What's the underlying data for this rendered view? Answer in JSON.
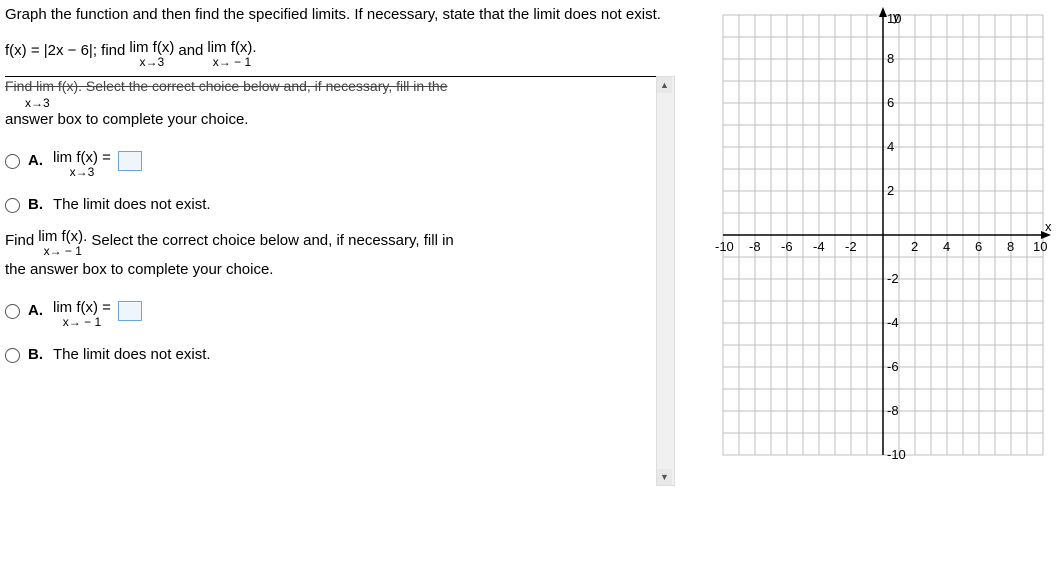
{
  "question": {
    "intro": "Graph the function and then find the specified limits. If necessary, state that the limit does not exist.",
    "func_prefix": "f(x) = |2x − 6|; find",
    "lim1_top": "lim f(x)",
    "lim1_bot": "x→3",
    "and": "and",
    "lim2_top": "lim  f(x).",
    "lim2_bot": "x→ − 1",
    "truncated_line": "Find  lim f(x). Select the correct choice below and, if necessary, fill in the",
    "trunc_sub_top": "x→3",
    "answer_box_text": "answer box to complete your choice."
  },
  "part1": {
    "A_label": "A.",
    "A_lim_top": "lim f(x) =",
    "A_lim_bot": "x→3",
    "B_label": "B.",
    "B_text": "The limit does not exist."
  },
  "part2": {
    "find_prefix": "Find",
    "lim_top": "lim  f(x).",
    "lim_bot": "x→ − 1",
    "find_suffix": "Select the correct choice below and, if necessary, fill in",
    "line2": "the answer box to complete your choice.",
    "A_label": "A.",
    "A_lim_top": "lim  f(x) =",
    "A_lim_bot": "x→ − 1",
    "B_label": "B.",
    "B_text": "The limit does not exist."
  },
  "chart_data": {
    "type": "line",
    "title": "",
    "xlabel": "x",
    "ylabel": "y",
    "xlim": [
      -10,
      10
    ],
    "ylim": [
      -10,
      10
    ],
    "x_ticks": [
      -10,
      -8,
      -6,
      -4,
      -2,
      2,
      4,
      6,
      8,
      10
    ],
    "y_ticks": [
      -10,
      -8,
      -6,
      -4,
      -2,
      2,
      4,
      6,
      8,
      10
    ],
    "grid": true,
    "series": []
  }
}
